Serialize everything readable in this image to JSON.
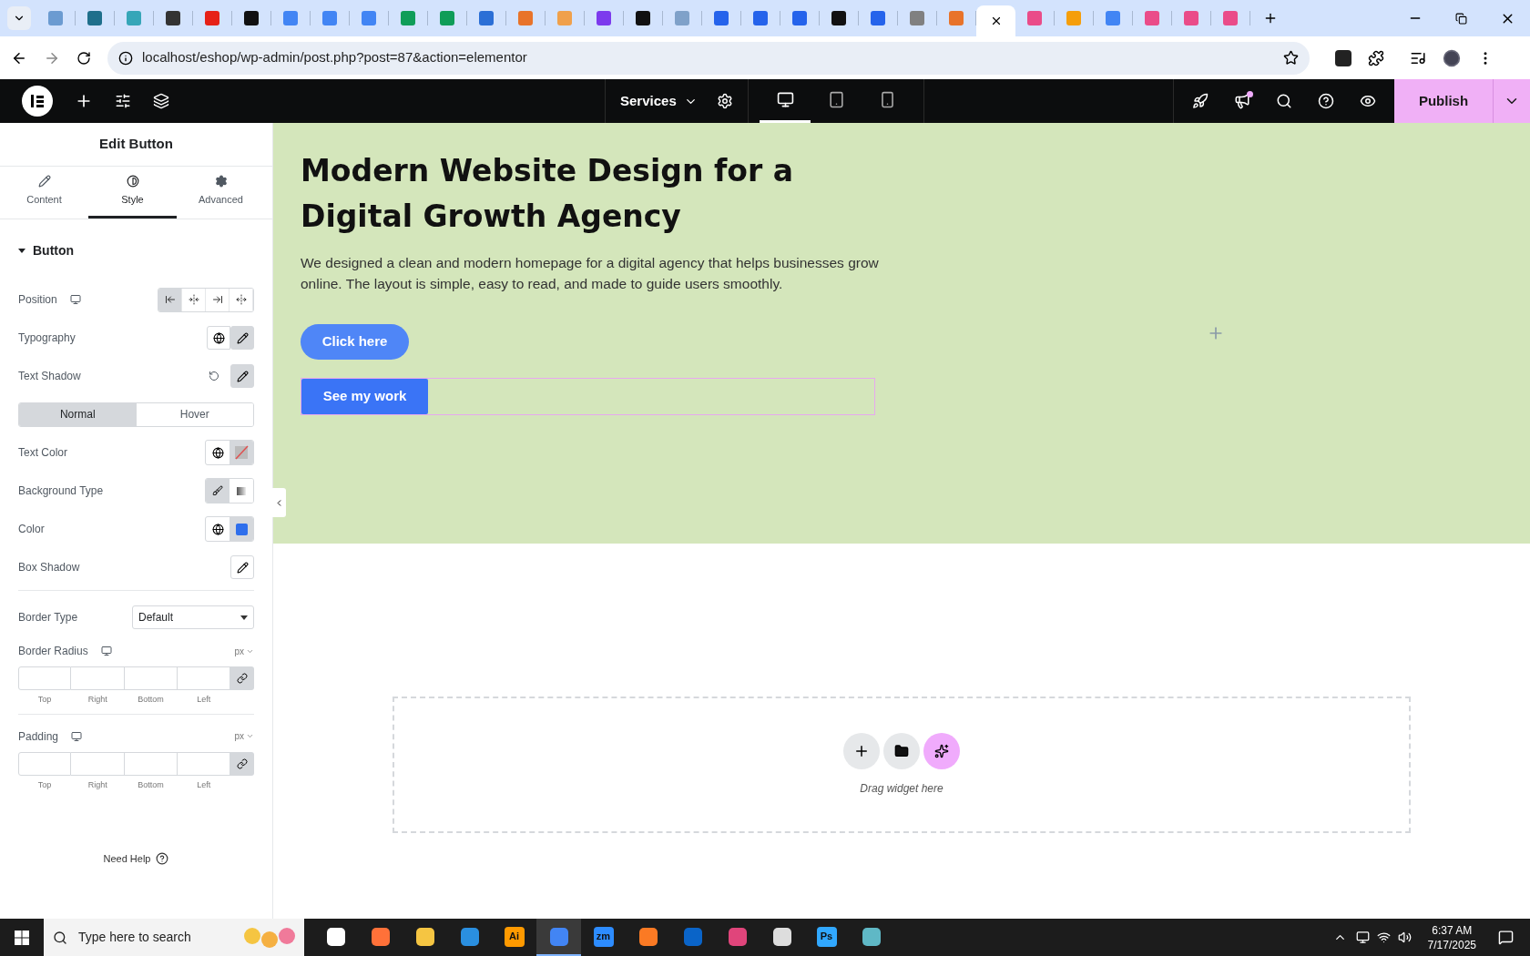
{
  "browser": {
    "tabs": [
      {
        "color": "#6b9bd1",
        "selected": false
      },
      {
        "color": "#1f6f8b",
        "selected": false
      },
      {
        "color": "#36a6b8",
        "selected": false
      },
      {
        "color": "#333333",
        "selected": false
      },
      {
        "color": "#e62117",
        "selected": false
      },
      {
        "color": "#111111",
        "selected": false
      },
      {
        "color": "#4285f4",
        "selected": false
      },
      {
        "color": "#4285f4",
        "selected": false
      },
      {
        "color": "#4285f4",
        "selected": false
      },
      {
        "color": "#0f9d58",
        "selected": false
      },
      {
        "color": "#0f9d58",
        "selected": false
      },
      {
        "color": "#2b6fd6",
        "selected": false
      },
      {
        "color": "#e8732a",
        "selected": false
      },
      {
        "color": "#f0a04b",
        "selected": false
      },
      {
        "color": "#7c3aed",
        "selected": false
      },
      {
        "color": "#111111",
        "selected": false
      },
      {
        "color": "#7fa1c9",
        "selected": false
      },
      {
        "color": "#2563eb",
        "selected": false
      },
      {
        "color": "#2563eb",
        "selected": false
      },
      {
        "color": "#2563eb",
        "selected": false
      },
      {
        "color": "#111111",
        "selected": false
      },
      {
        "color": "#2563eb",
        "selected": false
      },
      {
        "color": "#808080",
        "selected": false
      },
      {
        "color": "#e8732a",
        "selected": false
      },
      {
        "selected": true
      },
      {
        "color": "#ea4c89",
        "selected": false
      },
      {
        "color": "#f59e0b",
        "selected": false
      },
      {
        "color": "#4285f4",
        "selected": false
      },
      {
        "color": "#ea4c89",
        "selected": false
      },
      {
        "color": "#ea4c89",
        "selected": false
      },
      {
        "color": "#ea4c89",
        "selected": false
      }
    ],
    "url": "localhost/eshop/wp-admin/post.php?post=87&action=elementor"
  },
  "toolbar": {
    "page_menu": "Services",
    "devices": [
      {
        "kind": "desktop",
        "selected": true
      },
      {
        "kind": "tablet",
        "selected": false
      },
      {
        "kind": "mobile",
        "selected": false
      }
    ],
    "publish": "Publish"
  },
  "panel": {
    "title": "Edit Button",
    "tabs": [
      {
        "label": "Content",
        "kind": "pencil",
        "selected": false
      },
      {
        "label": "Style",
        "kind": "contrast",
        "selected": true
      },
      {
        "label": "Advanced",
        "kind": "gear",
        "selected": false
      }
    ],
    "section": {
      "title": "Button",
      "expanded": true
    },
    "groups": [
      [
        {
          "kind": "position",
          "label": "Position",
          "responsive": true,
          "options": [
            {
              "kind": "start",
              "selected": true
            },
            {
              "kind": "center",
              "selected": false
            },
            {
              "kind": "end",
              "selected": false
            },
            {
              "kind": "stretch",
              "selected": false
            }
          ]
        },
        {
          "kind": "popover",
          "label": "Typography",
          "global": true,
          "resettable": false,
          "active": true
        },
        {
          "kind": "popover",
          "label": "Text Shadow",
          "global": false,
          "resettable": true,
          "active": true
        },
        {
          "kind": "state_tabs",
          "options": [
            {
              "label": "Normal",
              "selected": true
            },
            {
              "label": "Hover",
              "selected": false
            }
          ]
        },
        {
          "kind": "color",
          "label": "Text Color"
        },
        {
          "kind": "choose",
          "label": "Background Type",
          "options": [
            {
              "kind": "classic",
              "selected": true
            },
            {
              "kind": "gradient",
              "selected": false
            }
          ]
        },
        {
          "kind": "color",
          "label": "Color",
          "color": "#2f6fec"
        },
        {
          "kind": "popover",
          "label": "Box Shadow",
          "global": false,
          "resettable": false,
          "active": false
        }
      ],
      [
        {
          "kind": "select",
          "label": "Border Type",
          "value": "Default"
        },
        {
          "kind": "dimensions",
          "label": "Border Radius",
          "responsive": true,
          "unit": "px",
          "sides": [
            "Top",
            "Right",
            "Bottom",
            "Left"
          ],
          "linked": true
        }
      ],
      [
        {
          "kind": "dimensions",
          "label": "Padding",
          "responsive": true,
          "unit": "px",
          "sides": [
            "Top",
            "Right",
            "Bottom",
            "Left"
          ],
          "linked": true
        }
      ]
    ],
    "help": "Need Help"
  },
  "canvas": {
    "heading": "Modern Website Design for a Digital Growth Agency",
    "text": "We designed a clean and modern homepage for a digital agency that helps businesses grow online. The layout is simple, easy to read, and made to guide users smoothly.",
    "buttons": [
      {
        "label": "Click here",
        "kind": "pill",
        "selected": false
      },
      {
        "label": "See my work",
        "kind": "square",
        "selected": true
      }
    ],
    "drop_zone": {
      "hint": "Drag widget here"
    }
  },
  "taskbar": {
    "search_placeholder": "Type here to search",
    "apps": [
      {
        "color": "#ffffff",
        "selected": false
      },
      {
        "color": "#ff7139",
        "selected": false
      },
      {
        "color": "#f5c542",
        "selected": false
      },
      {
        "color": "#2a8fe0",
        "selected": false
      },
      {
        "color": "#ff9a00",
        "glyph": "Ai",
        "selected": false
      },
      {
        "color": "#4285f4",
        "selected": true
      },
      {
        "color": "#2d8cff",
        "glyph": "zm",
        "selected": false
      },
      {
        "color": "#fb7a24",
        "selected": false
      },
      {
        "color": "#0a64c8",
        "selected": false
      },
      {
        "color": "#e0457b",
        "selected": false
      },
      {
        "color": "#dddddd",
        "selected": false
      },
      {
        "color": "#31a8ff",
        "glyph": "Ps",
        "selected": false
      },
      {
        "color": "#5fb8c6",
        "selected": false
      }
    ],
    "time": "6:37 AM",
    "date": "7/17/2025"
  }
}
